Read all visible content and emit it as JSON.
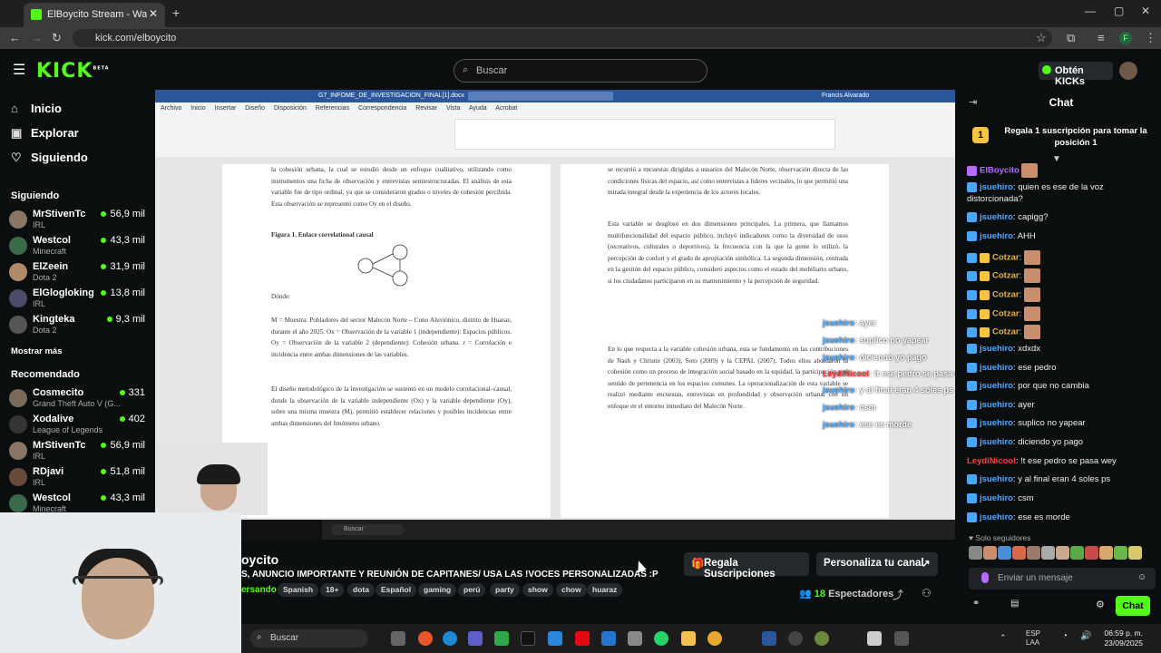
{
  "browser": {
    "tab_title": "ElBoycito Stream - Watch L",
    "url": "kick.com/elboycito",
    "profile_letter": "F"
  },
  "header": {
    "logo": "KICK",
    "logo_super": "BETA",
    "search_placeholder": "Buscar",
    "kicks_button": "Obtén KICKs"
  },
  "nav": [
    {
      "label": "Inicio",
      "icon": "home-icon"
    },
    {
      "label": "Explorar",
      "icon": "compass-icon"
    },
    {
      "label": "Siguiendo",
      "icon": "heart-icon"
    }
  ],
  "sidebar": {
    "following_title": "Siguiendo",
    "show_more": "Mostrar más",
    "recommended_title": "Recomendado",
    "following": [
      {
        "name": "MrStivenTc",
        "category": "IRL",
        "viewers": "56,9 mil"
      },
      {
        "name": "Westcol",
        "category": "Minecraft",
        "viewers": "43,3 mil"
      },
      {
        "name": "ElZeein",
        "category": "Dota 2",
        "viewers": "31,9 mil"
      },
      {
        "name": "ElGlogloking",
        "category": "IRL",
        "viewers": "13,8 mil"
      },
      {
        "name": "Kingteka",
        "category": "Dota 2",
        "viewers": "9,3 mil"
      }
    ],
    "recommended": [
      {
        "name": "Cosmecito",
        "category": "Grand Theft Auto V (G...",
        "viewers": "331"
      },
      {
        "name": "Xodalive",
        "category": "League of Legends",
        "viewers": "402"
      },
      {
        "name": "MrStivenTc",
        "category": "IRL",
        "viewers": "56,9 mil"
      },
      {
        "name": "RDjavi",
        "category": "IRL",
        "viewers": "51,8 mil"
      },
      {
        "name": "Westcol",
        "category": "Minecraft",
        "viewers": "43,3 mil"
      }
    ]
  },
  "stream": {
    "doc_title": "G7_INFOME_DE_INVESTIGACION_FINAL[1].docx",
    "doc_user": "Francis Alvarado",
    "ribbon_tabs": "Archivo Inicio Insertar Diseño Disposición Referencias Correspondencia Revisar Vista Ayuda Acrobat",
    "left_col_1": "la cohesión urbana, la cual se estudió desde un enfoque cualitativo, utilizando como instrumentos una ficha de observación y entrevistas semiestructuradas. El análisis de esta variable fue de tipo ordinal, ya que se consideraron grados o niveles de cohesión percibida. Esta observación se representó como Oy en el diseño.",
    "figure_caption": "Figura 1. Enlace correlational causal",
    "donde": "Dónde:",
    "left_col_2": "M = Muestra: Pobladores del sector Malecón Norte – Cono Aluviónico, distrito de Huaraz, durante el año 2025. Ox = Observación de la variable 1 (independiente): Espacios públicos. Oy = Observación de la variable 2 (dependiente): Cohesión urbana. r = Correlación e incidencia entre ambas dimensiones de las variables.",
    "left_col_3": "El diseño metodológico de la investigación se sustentó en un modelo correlacional–causal, donde la observación de la variable independiente (Ox) y la variable dependiente (Oy), sobre una misma muestra (M), permitió establecer relaciones y posibles incidencias entre ambas dimensiones del fenómeno urbano.",
    "right_col_1": "se recurrió a encuestas dirigidas a usuarios del Malecón Norte, observación directa de las condiciones físicas del espacio, así como entrevistas a líderes vecinales, lo que permitió una mirada integral desde la experiencia de los actores locales.",
    "right_col_2": "Esta variable se desglosó en dos dimensiones principales. La primera, que llamamos multifuncionalidad del espacio público, incluyó indicadores como la diversidad de usos (recreativos, culturales o deportivos), la frecuencia con la que la gente lo utilizó, la percepción de confort y el grado de apropiación simbólica. La segunda dimensión, centrada en la gestión del espacio público, consideró aspectos como el estado del mobiliario urbano, si los ciudadanos participaron en su mantenimiento y la percepción de seguridad.",
    "right_col_3": "En lo que respecta a la variable cohesión urbana, esta se fundamentó en las contribuciones de Nash y Christie (2003), Soto (2009) y la CEPAL (2007). Todos ellos abordaron la cohesión como un proceso de integración social basado en la equidad, la participación y el sentido de pertenencia en los espacios comunes. La operacionalización de esta variable se realizó mediante encuestas, entrevistas en profundidad y observación urbana, con un enfoque en el entorno inmediato del Malecón Norte.",
    "overlay_messages": [
      {
        "user": "jsuehiro",
        "text": ": ayer"
      },
      {
        "user": "jsuehiro",
        "text": ": suplico no yapear"
      },
      {
        "user": "jsuehiro",
        "text": ": diciendo yo pago"
      },
      {
        "user": "LeydiNicool",
        "text": ": !t ese pedro se pasa wey"
      },
      {
        "user": "jsuehiro",
        "text": ": y al final eran 4 soles ps"
      },
      {
        "user": "jsuehiro",
        "text": ": csm"
      },
      {
        "user": "jsuehiro",
        "text": ": ese es morde"
      }
    ],
    "inner_task_search": "Buscar"
  },
  "info": {
    "streamer": "oycito",
    "title": "S, ANUNCIO IMPORTANTE Y REUNIÓN DE CAPITANES/ USA LAS !VOCES PERSONALIZADAS :P",
    "category": "ersando",
    "tags": [
      "Spanish",
      "18+",
      "dota",
      "Español",
      "gaming",
      "perú",
      "party",
      "show",
      "chow",
      "huaraz"
    ],
    "gift_button": "Regala Suscripciones",
    "customize_button": "Personaliza tu canal",
    "viewer_count": "18",
    "viewer_label": "Espectadores"
  },
  "chat": {
    "title": "Chat",
    "promo": "Regala 1 suscripción para tomar la posición 1",
    "promo_rank": "1",
    "messages": [
      {
        "user": "ElBoycito",
        "text": "",
        "color": "purple"
      },
      {
        "user": "jsuehiro",
        "text": ": quien es ese de la voz distorcionada?",
        "color": "blue"
      },
      {
        "user": "jsuehiro",
        "text": ": capigg?",
        "color": "blue"
      },
      {
        "user": "jsuehiro",
        "text": ": AHH",
        "color": "blue"
      },
      {
        "user": "Cotzar",
        "text": ":",
        "color": "orange"
      },
      {
        "user": "Cotzar",
        "text": ":",
        "color": "orange"
      },
      {
        "user": "Cotzar",
        "text": ":",
        "color": "orange"
      },
      {
        "user": "Cotzar",
        "text": ":",
        "color": "orange"
      },
      {
        "user": "Cotzar",
        "text": ":",
        "color": "orange"
      },
      {
        "user": "jsuehiro",
        "text": ": xdxdx",
        "color": "blue"
      },
      {
        "user": "jsuehiro",
        "text": ": ese pedro",
        "color": "blue"
      },
      {
        "user": "jsuehiro",
        "text": ": por que no cambia",
        "color": "blue"
      },
      {
        "user": "jsuehiro",
        "text": ": ayer",
        "color": "blue"
      },
      {
        "user": "jsuehiro",
        "text": ": suplico no yapear",
        "color": "blue"
      },
      {
        "user": "jsuehiro",
        "text": ": diciendo yo pago",
        "color": "blue"
      },
      {
        "user": "LeydiNicool",
        "text": ": !t ese pedro se pasa wey",
        "color": "red"
      },
      {
        "user": "jsuehiro",
        "text": ": y al final eran 4 soles ps",
        "color": "blue"
      },
      {
        "user": "jsuehiro",
        "text": ": csm",
        "color": "blue"
      },
      {
        "user": "jsuehiro",
        "text": ": ese es morde",
        "color": "blue"
      }
    ],
    "followers_only": "Solo seguidores",
    "input_placeholder": "Enviar un mensaje",
    "send_button": "Chat"
  },
  "taskbar": {
    "search": "Buscar",
    "lang": "ESP",
    "lang2": "LAA",
    "time": "06:59 p. m.",
    "date": "23/09/2025"
  },
  "colors": {
    "accent": "#53fc18",
    "background": "#0b0e0f",
    "user_blue": "#4aa8ff",
    "user_red": "#ff3b3b"
  }
}
